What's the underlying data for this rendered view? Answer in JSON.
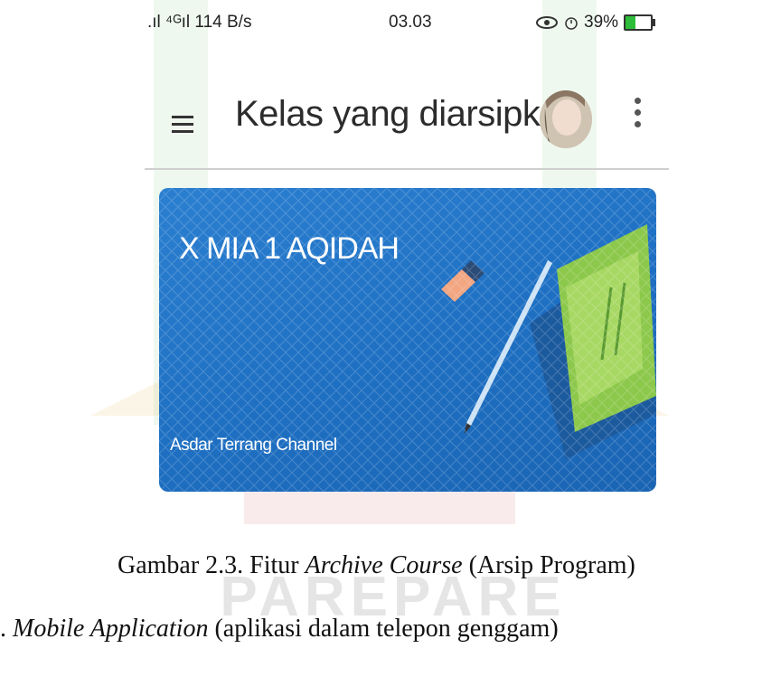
{
  "status_bar": {
    "signal_text": ".ıl ⁴ᴳıl 114 B/s",
    "time": "03.03",
    "battery_text": "39%",
    "icons": [
      "signal-icon",
      "eye-icon",
      "alarm-icon",
      "battery-icon"
    ]
  },
  "app_bar": {
    "title": "Kelas yang diarsipkan",
    "menu_icon": "hamburger-menu-icon",
    "more_icon": "kebab-more-icon"
  },
  "course_card": {
    "title": "X MIA 1 AQIDAH",
    "subtitle": "Asdar Terrang Channel",
    "color": "#1e6fc2"
  },
  "figure_caption": {
    "prefix": "Gambar 2.3. Fitur ",
    "italic": "Archive Course",
    "suffix": " (Arsip Program)"
  },
  "body_text": {
    "prefix": ". ",
    "italic": "Mobile Application",
    "suffix": " (aplikasi dalam telepon genggam)"
  },
  "watermark": "PAREPARE"
}
